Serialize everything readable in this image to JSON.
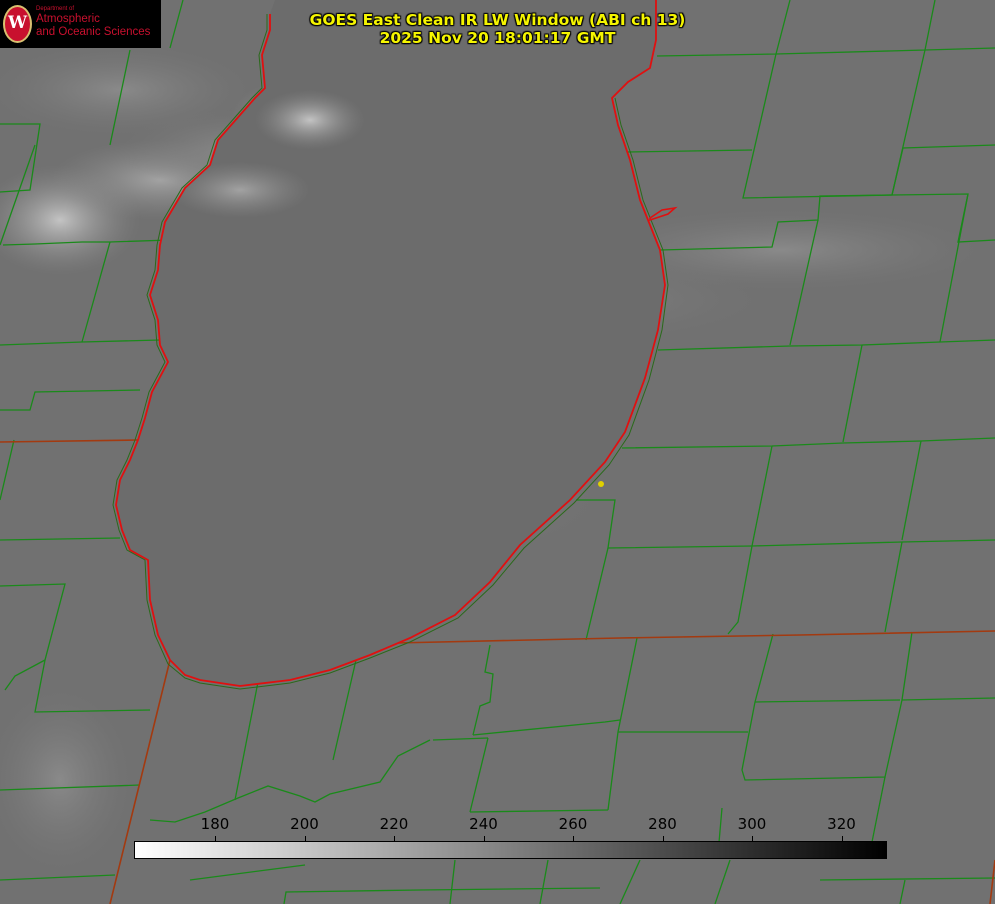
{
  "title": {
    "line1": "GOES East Clean IR LW Window (ABI ch 13)",
    "line2": "2025 Nov 20 18:01:17 GMT"
  },
  "logo": {
    "dept": "Department of",
    "line1": "Atmospheric",
    "line2": "and Oceanic Sciences",
    "seal_letter": "W"
  },
  "colorbar": {
    "ticks": [
      "180",
      "200",
      "220",
      "240",
      "260",
      "280",
      "300",
      "320"
    ],
    "gradient_start": "#ffffff",
    "gradient_end": "#000000"
  },
  "colors": {
    "county_lines": "#1a8a1a",
    "state_lines": "#a33a10",
    "lake_shore": "#e01010",
    "title_text": "#f5f500",
    "marker": "#e0d000"
  }
}
